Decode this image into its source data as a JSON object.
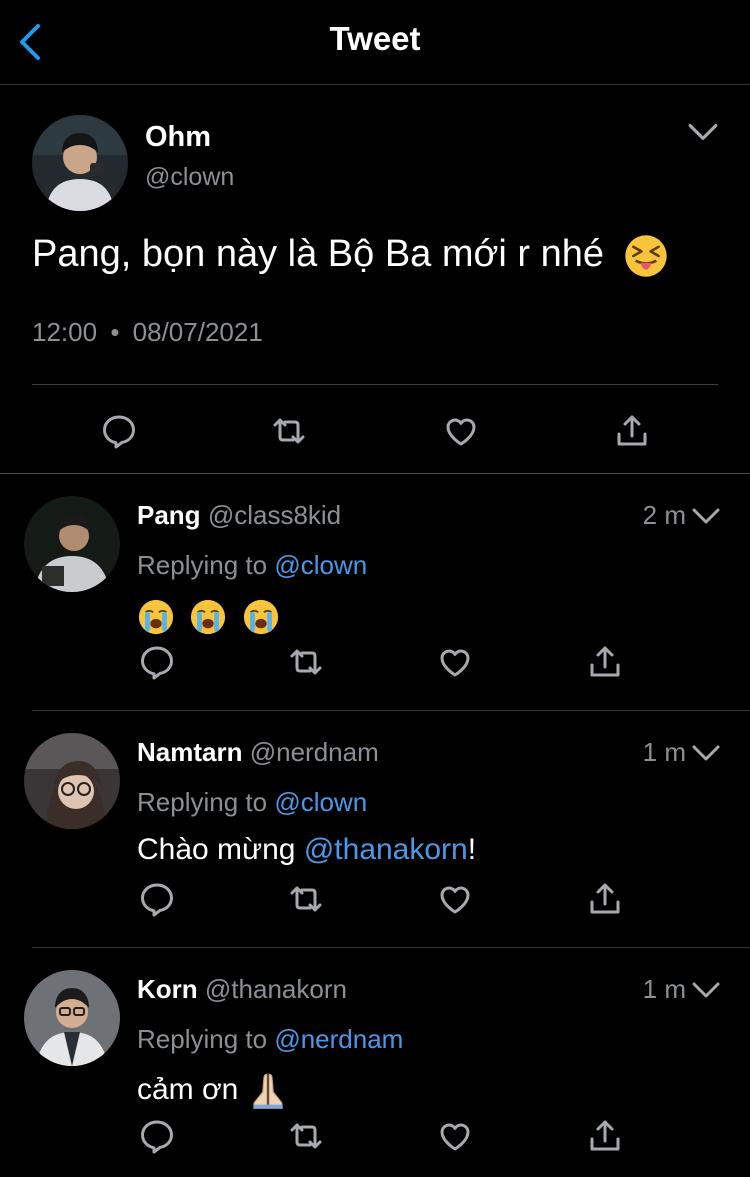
{
  "header": {
    "title": "Tweet"
  },
  "tweet": {
    "name": "Ohm",
    "handle": "@clown",
    "text": "Pang, bọn này là Bộ Ba mới r nhé",
    "emoji": "squinting-tongue-face",
    "time": "12:00",
    "separator": "•",
    "date": "08/07/2021"
  },
  "replies": [
    {
      "name": "Pang",
      "handle": "@class8kid",
      "time": "2 m",
      "replying_prefix": "Replying to",
      "replying_to": "@clown",
      "body_emojis": [
        "loudly-crying-face",
        "loudly-crying-face",
        "loudly-crying-face"
      ]
    },
    {
      "name": "Namtarn",
      "handle": "@nerdnam",
      "time": "1 m",
      "replying_prefix": "Replying to",
      "replying_to": "@clown",
      "body_text": "Chào mừng ",
      "body_mention": "@thanakorn",
      "body_suffix": "!"
    },
    {
      "name": "Korn",
      "handle": "@thanakorn",
      "time": "1 m",
      "replying_prefix": "Replying to",
      "replying_to": "@nerdnam",
      "body_text": "cảm ơn ",
      "body_emoji": "folded-hands"
    }
  ],
  "colors": {
    "background": "#000000",
    "accent": "#4a99e9",
    "muted": "#8b9095",
    "icon": "#a6a9ad"
  }
}
